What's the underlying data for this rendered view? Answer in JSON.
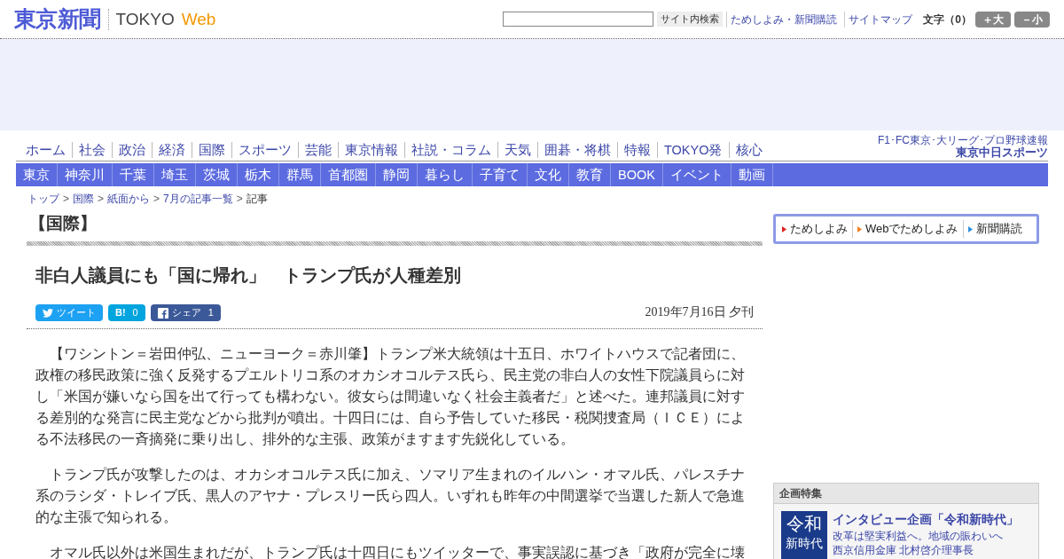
{
  "header": {
    "logo": "東京新聞",
    "logo_sub": "TOKYO",
    "logo_web": "Web",
    "search": {
      "button": "サイト内検索"
    },
    "links": [
      "ためしよみ・新聞購読",
      "サイトマップ"
    ],
    "font_size": {
      "label": "文字（0）",
      "buttons": [
        "＋大",
        "－小"
      ]
    }
  },
  "nav_main": [
    "ホーム",
    "社会",
    "政治",
    "経済",
    "国際",
    "スポーツ",
    "芸能",
    "東京情報",
    "社説・コラム",
    "天気",
    "囲碁・将棋",
    "特報",
    "TOKYO発",
    "核心"
  ],
  "sports_promo": {
    "line1": "F1･FC東京･大リーグ･プロ野球速報",
    "line2": "東京中日スポーツ"
  },
  "nav_local": [
    "東京",
    "神奈川",
    "千葉",
    "埼玉",
    "茨城",
    "栃木",
    "群馬",
    "首都圏",
    "静岡",
    "暮らし",
    "子育て",
    "文化",
    "教育",
    "BOOK",
    "イベント",
    "動画"
  ],
  "breadcrumb": {
    "separator": ">",
    "items": [
      "トップ",
      "国際",
      "紙面から",
      "7月の記事一覧",
      "記事"
    ]
  },
  "article": {
    "section": "【国際】",
    "title": "非白人議員にも「国に帰れ」　トランプ氏が人種差別",
    "share": [
      {
        "kind": "twitter",
        "label": "ツイート"
      },
      {
        "kind": "hatena",
        "label": "B!",
        "count": "0"
      },
      {
        "kind": "facebook",
        "label": "シェア",
        "count": "1"
      }
    ],
    "date": "2019年7月16日 夕刊",
    "paragraphs": [
      "【ワシントン＝岩田仲弘、ニューヨーク＝赤川肇】トランプ米大統領は十五日、ホワイトハウスで記者団に、政権の移民政策に強く反発するプエルトリコ系のオカシオコルテス氏ら、民主党の非白人の女性下院議員らに対し「米国が嫌いなら国を出て行っても構わない。彼女らは間違いなく社会主義者だ」と述べた。連邦議員に対する差別的な発言に民主党などから批判が噴出。十四日には、自ら予告していた移民・税関捜査局（ＩＣＥ）による不法移民の一斉摘発に乗り出し、排外的な主張、政策がますます先鋭化している。",
      "トランプ氏が攻撃したのは、オカシオコルテス氏に加え、ソマリア生まれのイルハン・オマル氏、パレスチナ系のラシダ・トレイブ氏、黒人のアヤナ・プレスリー氏ら四人。いずれも昨年の中間選挙で当選した新人で急進的な主張で知られる。",
      "オマル氏以外は米国生まれだが、トランプ氏は十四日にもツイッターで、事実誤認に基づき「政府が完全に壊"
    ]
  },
  "subscribe": [
    {
      "label": "ためしよみ",
      "color": "#e02020"
    },
    {
      "label": "Webでためしよみ",
      "color": "#f08020"
    },
    {
      "label": "新聞購読",
      "color": "#3090e0"
    }
  ],
  "feature": {
    "heading": "企画特集",
    "thumb": [
      "令和",
      "新時代"
    ],
    "title": "インタビュー企画「令和新時代」",
    "lines": [
      "改革は堅実利益へ。地域の賑わいへ",
      "西京信用金庫 北村啓介理事長"
    ]
  }
}
